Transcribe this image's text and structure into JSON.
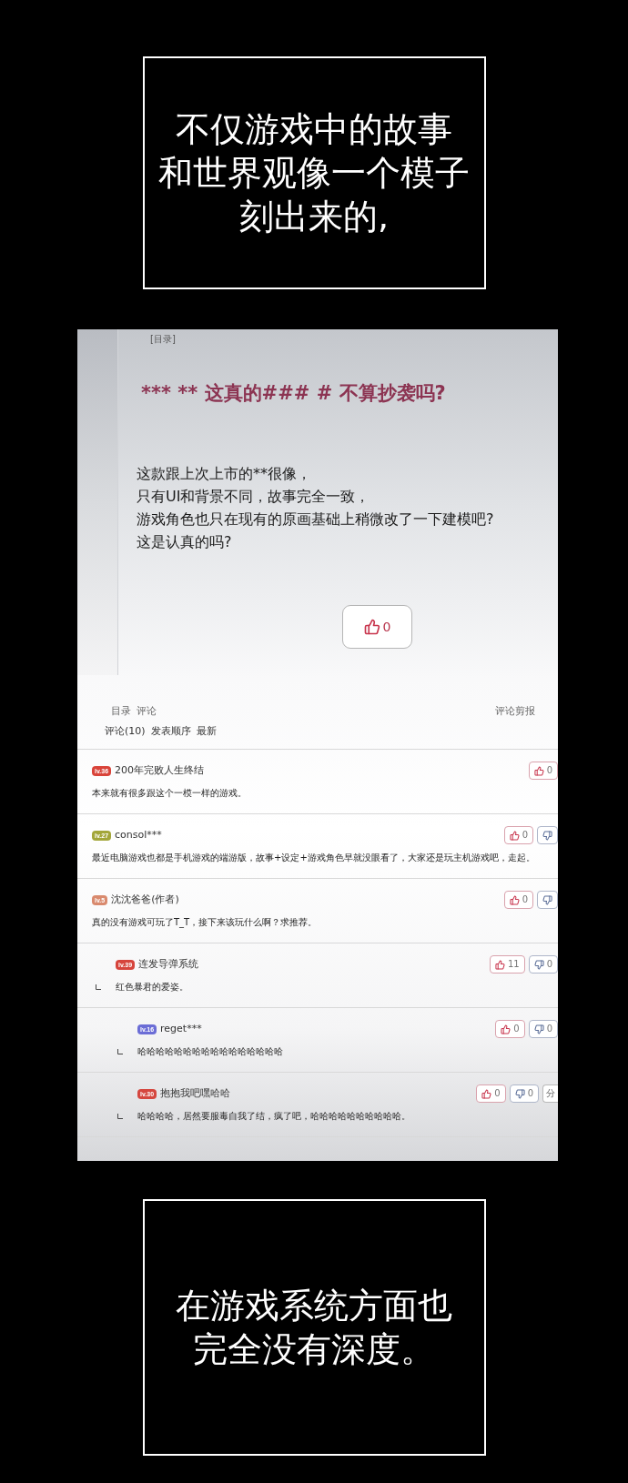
{
  "caption_top": {
    "lines": [
      "不仅游戏中的故事",
      "和世界观像一个模子",
      "刻出来的,"
    ]
  },
  "screenshot": {
    "toc_link": "[目录]",
    "post": {
      "title": "*** ** 这真的### # 不算抄袭吗?",
      "body_lines": [
        "这款跟上次上市的**很像，",
        "只有UI和背景不同，故事完全一致，",
        "游戏角色也只在现有的原画基础上稍微改了一下建模吧?",
        "这是认真的吗?"
      ],
      "like_button": {
        "count": "0"
      }
    },
    "nav": {
      "links": [
        "目录",
        "评论"
      ],
      "clip_link": "评论剪报"
    },
    "sort_bar": {
      "count_label": "评论(10)",
      "options": [
        "发表顺序",
        "最新"
      ]
    },
    "comments": [
      {
        "badge": {
          "label": "lv.36",
          "color": "#d9443a"
        },
        "author": "200年完败人生终结",
        "text": "本来就有很多跟这个一模一样的游戏。",
        "buttons": [
          {
            "kind": "like",
            "count": "0"
          }
        ]
      },
      {
        "badge": {
          "label": "lv.27",
          "color": "#a3a63a"
        },
        "author": "consol***",
        "text": "最近电脑游戏也都是手机游戏的端游版，故事+设定+游戏角色早就没眼看了，大家还是玩主机游戏吧，走起。",
        "buttons": [
          {
            "kind": "like",
            "count": "0"
          },
          {
            "kind": "dislike"
          }
        ]
      },
      {
        "badge": {
          "label": "lv.5",
          "color": "#d98a6e"
        },
        "author": "沈沈爸爸(作者)",
        "text": "真的没有游戏可玩了T_T，接下来该玩什么啊？求推荐。",
        "buttons": [
          {
            "kind": "like",
            "count": "0"
          },
          {
            "kind": "dislike"
          }
        ],
        "children": [
          {
            "badge": {
              "label": "lv.39",
              "color": "#d6443c"
            },
            "author": "连发导弹系统",
            "text": "红色暴君的爱姿。",
            "buttons": [
              {
                "kind": "like",
                "count": "11"
              },
              {
                "kind": "dislike",
                "count": "0"
              }
            ],
            "children": [
              {
                "badge": {
                  "label": "lv.16",
                  "color": "#6b6dd6"
                },
                "author": "reget***",
                "text": "哈哈哈哈哈哈哈哈哈哈哈哈哈哈哈哈",
                "buttons": [
                  {
                    "kind": "like",
                    "count": "0"
                  },
                  {
                    "kind": "dislike",
                    "count": "0"
                  }
                ]
              },
              {
                "badge": {
                  "label": "lv.30",
                  "color": "#d5473f"
                },
                "author": "抱抱我吧嘿哈哈",
                "text": "哈哈哈哈，居然要服毒自我了结，疯了吧，哈哈哈哈哈哈哈哈哈哈。",
                "buttons": [
                  {
                    "kind": "like",
                    "count": "0"
                  },
                  {
                    "kind": "dislike",
                    "count": "0"
                  },
                  {
                    "kind": "share",
                    "label": "分"
                  }
                ]
              }
            ]
          }
        ]
      }
    ]
  },
  "caption_bottom": {
    "lines": [
      "在游戏系统方面也",
      "完全没有深度。"
    ]
  }
}
